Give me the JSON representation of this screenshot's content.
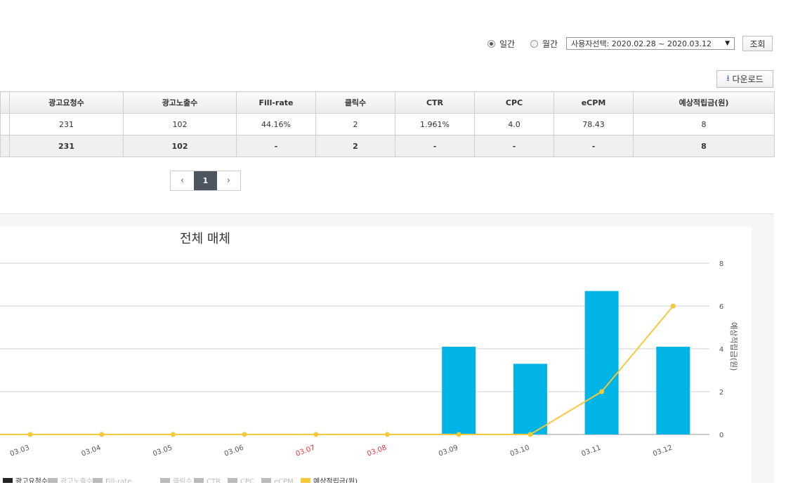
{
  "filters": {
    "radios": [
      {
        "label": "일간",
        "checked": true
      },
      {
        "label": "월간",
        "checked": false
      }
    ],
    "date_select": "사용자선택: 2020.02.28 ~ 2020.03.12",
    "search_button": "조회"
  },
  "download_button": "다운로드",
  "table": {
    "headers": [
      "광고요청수",
      "광고노출수",
      "Fill-rate",
      "클릭수",
      "CTR",
      "CPC",
      "eCPM",
      "예상적립금(원)"
    ],
    "rows": [
      [
        "231",
        "102",
        "44.16%",
        "2",
        "1.961%",
        "4.0",
        "78.43",
        "8"
      ]
    ],
    "total": [
      "231",
      "102",
      "-",
      "2",
      "-",
      "-",
      "-",
      "8"
    ]
  },
  "pagination": {
    "prev": "‹",
    "current": "1",
    "next": "›"
  },
  "chart_data": {
    "type": "bar",
    "title": "전체 매체",
    "x": [
      "03.03",
      "03.04",
      "03.05",
      "03.06",
      "03.07",
      "03.08",
      "03.09",
      "03.10",
      "03.11",
      "03.12"
    ],
    "weekend_color": "#e8333a",
    "weekend_labels": [
      "03.07",
      "03.08"
    ],
    "right_axis": {
      "label": "예상적립금(원)",
      "ticks": [
        0,
        2,
        4,
        6,
        8
      ],
      "ylim": [
        0,
        8
      ]
    },
    "series": [
      {
        "name": "광고요청수",
        "type": "bar",
        "color": "#00b4e6",
        "values": [
          0,
          0,
          0,
          0,
          0,
          0,
          4.1,
          3.3,
          6.7,
          4.1
        ]
      },
      {
        "name": "예상적립금(원)",
        "type": "line",
        "color": "#f5c93c",
        "values": [
          0,
          0,
          0,
          0,
          0,
          0,
          0,
          0,
          2,
          6
        ]
      }
    ],
    "legend": [
      "광고요청수",
      "광고노출수",
      "Fill-rate",
      "클릭수",
      "CTR",
      "CPC",
      "eCPM",
      "예상적립금(원)"
    ],
    "legend_position": "bottom",
    "grid": true
  }
}
